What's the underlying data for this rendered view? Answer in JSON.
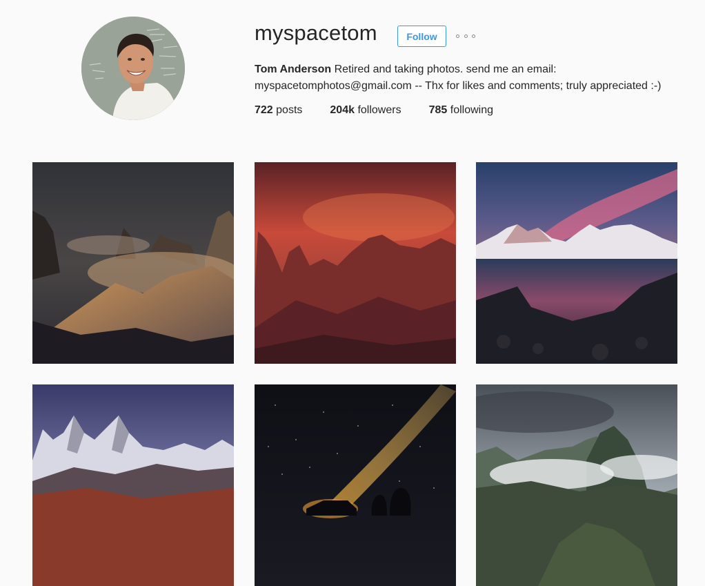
{
  "profile": {
    "username": "myspacetom",
    "follow_label": "Follow",
    "more_icon": "ellipsis-icon",
    "full_name": "Tom Anderson",
    "bio_line1": "Retired and taking photos. send me an email:",
    "bio_line2": "myspacetomphotos@gmail.com -- Thx for likes and comments; truly appreciated :-)",
    "stats": {
      "posts_count": "722",
      "posts_label": "posts",
      "followers_count": "204k",
      "followers_label": "followers",
      "following_count": "785",
      "following_label": "following"
    }
  },
  "colors": {
    "accent": "#3897f0",
    "text": "#262626",
    "background": "#fafafa"
  },
  "posts": [
    {
      "subject": "misty mountain peaks at dusk"
    },
    {
      "subject": "red sunset over jagged peaks"
    },
    {
      "subject": "snowy peaks reflected in lake at sunset"
    },
    {
      "subject": "snowy peaks above autumn foliage"
    },
    {
      "subject": "milky way over silhouetted people and car"
    },
    {
      "subject": "cloud-covered green peak"
    }
  ]
}
